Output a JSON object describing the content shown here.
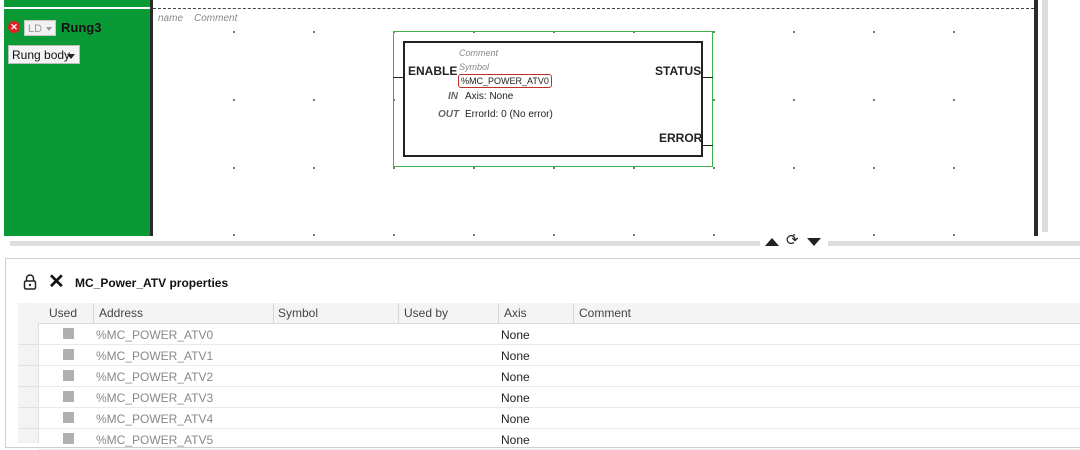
{
  "rung": {
    "language": "LD",
    "name": "Rung3",
    "body_select": "Rung body",
    "name_placeholder": "name",
    "comment_placeholder": "Comment"
  },
  "function_block": {
    "comment": "Comment",
    "symbol": "Symbol",
    "instance": "%MC_POWER_ATV0",
    "inputs": {
      "enable": "ENABLE"
    },
    "outputs": {
      "status": "STATUS",
      "error": "ERROR"
    },
    "in_label": "IN",
    "in_value": "Axis: None",
    "out_label": "OUT",
    "out_value": "ErrorId: 0 (No error)"
  },
  "colors": {
    "rung_green": "#0a9a35",
    "selection": "#3fb04f",
    "instance_border": "#c0302b"
  },
  "properties": {
    "title": "MC_Power_ATV properties",
    "columns": [
      "Used",
      "Address",
      "Symbol",
      "Used by",
      "Axis",
      "Comment"
    ],
    "rows": [
      {
        "address": "%MC_POWER_ATV0",
        "axis": "None"
      },
      {
        "address": "%MC_POWER_ATV1",
        "axis": "None"
      },
      {
        "address": "%MC_POWER_ATV2",
        "axis": "None"
      },
      {
        "address": "%MC_POWER_ATV3",
        "axis": "None"
      },
      {
        "address": "%MC_POWER_ATV4",
        "axis": "None"
      },
      {
        "address": "%MC_POWER_ATV5",
        "axis": "None"
      }
    ]
  },
  "icons": [
    "error-icon",
    "chevron-down-icon",
    "lock-icon",
    "close-icon",
    "arrow-up-icon",
    "sync-icon",
    "arrow-down-icon"
  ]
}
